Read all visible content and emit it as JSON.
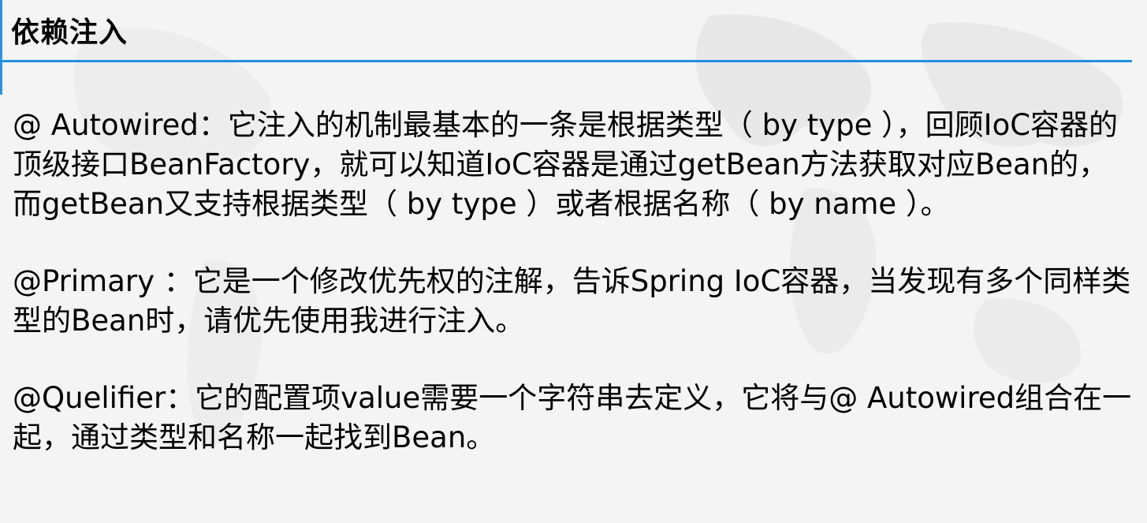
{
  "header": {
    "title": "依赖注入"
  },
  "paragraphs": [
    "@ Autowired：它注入的机制最基本的一条是根据类型（ by type ），回顾IoC容器的顶级接口BeanFactory，就可以知道IoC容器是通过getBean方法获取对应Bean的，而getBean又支持根据类型（ by type ）或者根据名称（ by name ）。",
    "@Primary ：它是一个修改优先权的注解，告诉Spring IoC容器，当发现有多个同样类型的Bean时，请优先使用我进行注入。",
    "@Quelifier：它的配置项value需要一个字符串去定义，它将与@ Autowired组合在一起，通过类型和名称一起找到Bean。"
  ]
}
